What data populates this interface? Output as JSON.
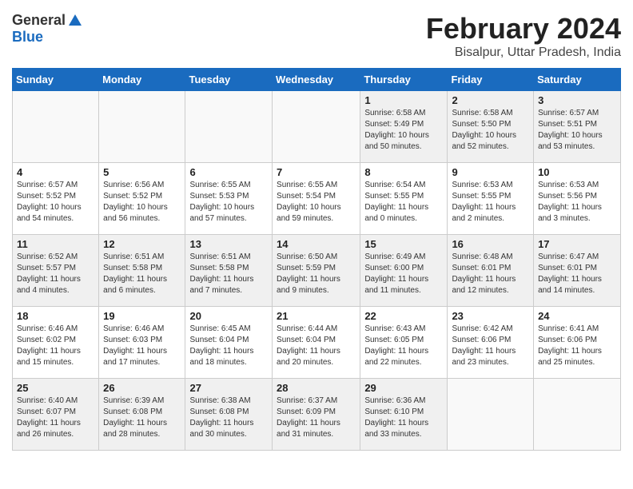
{
  "logo": {
    "general": "General",
    "blue": "Blue"
  },
  "title": "February 2024",
  "location": "Bisalpur, Uttar Pradesh, India",
  "days": [
    "Sunday",
    "Monday",
    "Tuesday",
    "Wednesday",
    "Thursday",
    "Friday",
    "Saturday"
  ],
  "weeks": [
    [
      {
        "day": "",
        "info": ""
      },
      {
        "day": "",
        "info": ""
      },
      {
        "day": "",
        "info": ""
      },
      {
        "day": "",
        "info": ""
      },
      {
        "day": "1",
        "info": "Sunrise: 6:58 AM\nSunset: 5:49 PM\nDaylight: 10 hours\nand 50 minutes."
      },
      {
        "day": "2",
        "info": "Sunrise: 6:58 AM\nSunset: 5:50 PM\nDaylight: 10 hours\nand 52 minutes."
      },
      {
        "day": "3",
        "info": "Sunrise: 6:57 AM\nSunset: 5:51 PM\nDaylight: 10 hours\nand 53 minutes."
      }
    ],
    [
      {
        "day": "4",
        "info": "Sunrise: 6:57 AM\nSunset: 5:52 PM\nDaylight: 10 hours\nand 54 minutes."
      },
      {
        "day": "5",
        "info": "Sunrise: 6:56 AM\nSunset: 5:52 PM\nDaylight: 10 hours\nand 56 minutes."
      },
      {
        "day": "6",
        "info": "Sunrise: 6:55 AM\nSunset: 5:53 PM\nDaylight: 10 hours\nand 57 minutes."
      },
      {
        "day": "7",
        "info": "Sunrise: 6:55 AM\nSunset: 5:54 PM\nDaylight: 10 hours\nand 59 minutes."
      },
      {
        "day": "8",
        "info": "Sunrise: 6:54 AM\nSunset: 5:55 PM\nDaylight: 11 hours\nand 0 minutes."
      },
      {
        "day": "9",
        "info": "Sunrise: 6:53 AM\nSunset: 5:55 PM\nDaylight: 11 hours\nand 2 minutes."
      },
      {
        "day": "10",
        "info": "Sunrise: 6:53 AM\nSunset: 5:56 PM\nDaylight: 11 hours\nand 3 minutes."
      }
    ],
    [
      {
        "day": "11",
        "info": "Sunrise: 6:52 AM\nSunset: 5:57 PM\nDaylight: 11 hours\nand 4 minutes."
      },
      {
        "day": "12",
        "info": "Sunrise: 6:51 AM\nSunset: 5:58 PM\nDaylight: 11 hours\nand 6 minutes."
      },
      {
        "day": "13",
        "info": "Sunrise: 6:51 AM\nSunset: 5:58 PM\nDaylight: 11 hours\nand 7 minutes."
      },
      {
        "day": "14",
        "info": "Sunrise: 6:50 AM\nSunset: 5:59 PM\nDaylight: 11 hours\nand 9 minutes."
      },
      {
        "day": "15",
        "info": "Sunrise: 6:49 AM\nSunset: 6:00 PM\nDaylight: 11 hours\nand 11 minutes."
      },
      {
        "day": "16",
        "info": "Sunrise: 6:48 AM\nSunset: 6:01 PM\nDaylight: 11 hours\nand 12 minutes."
      },
      {
        "day": "17",
        "info": "Sunrise: 6:47 AM\nSunset: 6:01 PM\nDaylight: 11 hours\nand 14 minutes."
      }
    ],
    [
      {
        "day": "18",
        "info": "Sunrise: 6:46 AM\nSunset: 6:02 PM\nDaylight: 11 hours\nand 15 minutes."
      },
      {
        "day": "19",
        "info": "Sunrise: 6:46 AM\nSunset: 6:03 PM\nDaylight: 11 hours\nand 17 minutes."
      },
      {
        "day": "20",
        "info": "Sunrise: 6:45 AM\nSunset: 6:04 PM\nDaylight: 11 hours\nand 18 minutes."
      },
      {
        "day": "21",
        "info": "Sunrise: 6:44 AM\nSunset: 6:04 PM\nDaylight: 11 hours\nand 20 minutes."
      },
      {
        "day": "22",
        "info": "Sunrise: 6:43 AM\nSunset: 6:05 PM\nDaylight: 11 hours\nand 22 minutes."
      },
      {
        "day": "23",
        "info": "Sunrise: 6:42 AM\nSunset: 6:06 PM\nDaylight: 11 hours\nand 23 minutes."
      },
      {
        "day": "24",
        "info": "Sunrise: 6:41 AM\nSunset: 6:06 PM\nDaylight: 11 hours\nand 25 minutes."
      }
    ],
    [
      {
        "day": "25",
        "info": "Sunrise: 6:40 AM\nSunset: 6:07 PM\nDaylight: 11 hours\nand 26 minutes."
      },
      {
        "day": "26",
        "info": "Sunrise: 6:39 AM\nSunset: 6:08 PM\nDaylight: 11 hours\nand 28 minutes."
      },
      {
        "day": "27",
        "info": "Sunrise: 6:38 AM\nSunset: 6:08 PM\nDaylight: 11 hours\nand 30 minutes."
      },
      {
        "day": "28",
        "info": "Sunrise: 6:37 AM\nSunset: 6:09 PM\nDaylight: 11 hours\nand 31 minutes."
      },
      {
        "day": "29",
        "info": "Sunrise: 6:36 AM\nSunset: 6:10 PM\nDaylight: 11 hours\nand 33 minutes."
      },
      {
        "day": "",
        "info": ""
      },
      {
        "day": "",
        "info": ""
      }
    ]
  ]
}
